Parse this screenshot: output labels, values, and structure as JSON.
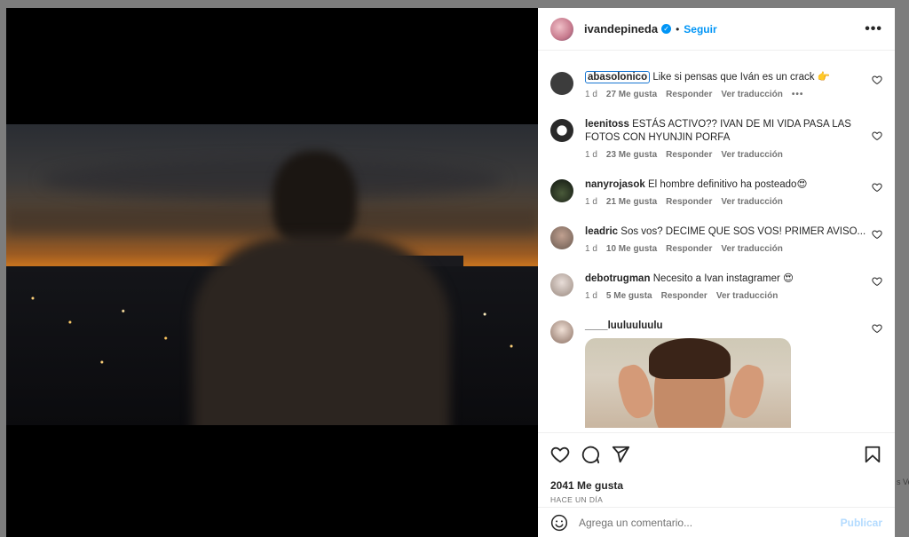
{
  "post": {
    "author": "ivandepineda",
    "follow_label": "Seguir",
    "separator": "•",
    "verified_mark": "✓"
  },
  "comments": [
    {
      "user": "abasolonico",
      "text": "Like si pensas que Iván es un crack 👉",
      "age": "1 d",
      "likes": "27 Me gusta",
      "reply": "Responder",
      "translate": "Ver traducción",
      "more": "•••",
      "avatar_color": "#3c3c3c"
    },
    {
      "user": "leenitoss",
      "text": "ESTÁS ACTIVO?? IVAN DE MI VIDA PASA LAS FOTOS CON HYUNJIN PORFA",
      "age": "1 d",
      "likes": "23 Me gusta",
      "reply": "Responder",
      "translate": "Ver traducción",
      "avatar_color": "#2a2a2a"
    },
    {
      "user": "nanyrojasok",
      "text": "El hombre definitivo ha posteado😍",
      "age": "1 d",
      "likes": "21 Me gusta",
      "reply": "Responder",
      "translate": "Ver traducción",
      "avatar_color": "#1f2a1f"
    },
    {
      "user": "leadric",
      "text": "Sos vos? DECIME QUE SOS VOS! PRIMER AVISO...",
      "age": "1 d",
      "likes": "10 Me gusta",
      "reply": "Responder",
      "translate": "Ver traducción",
      "avatar_color": "#8a6a5a"
    },
    {
      "user": "debotrugman",
      "text": "Necesito a Ivan instagramer 😍",
      "age": "1 d",
      "likes": "5 Me gusta",
      "reply": "Responder",
      "translate": "Ver traducción",
      "avatar_color": "#b8a8a0"
    },
    {
      "user": "____luuluuluulu",
      "text": "",
      "avatar_color": "#c9b3a6"
    }
  ],
  "footer": {
    "likes_total": "2041 Me gusta",
    "timestamp": "HACE UN DÍA",
    "comment_placeholder": "Agrega un comentario...",
    "publish_label": "Publicar"
  },
  "background_peek": "s Ve",
  "colors": {
    "accent": "#0095f6",
    "publish_disabled": "#b3dbff"
  },
  "icons": [
    "heart-icon",
    "comment-icon",
    "share-icon",
    "bookmark-icon",
    "emoji-icon",
    "verified-icon",
    "more-options-icon"
  ]
}
